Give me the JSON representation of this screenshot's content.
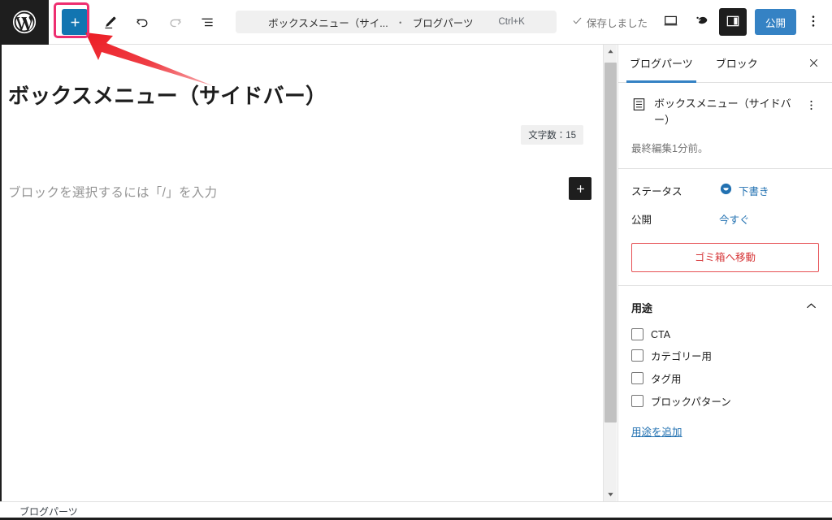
{
  "toolbar": {
    "logo_icon": "wordpress-logo-icon",
    "inserter_label": "+",
    "edit_icon": "pencil-icon",
    "undo_icon": "undo-icon",
    "redo_icon": "redo-icon",
    "listview_icon": "list-view-icon",
    "command_bar": {
      "title": "ボックスメニュー（サイ...",
      "separator": "・",
      "post_type": "ブログパーツ",
      "shortcut": "Ctrl+K"
    },
    "saved_status": "保存しました",
    "saved_check_icon": "check-icon",
    "view_icon": "desktop-preview-icon",
    "jetpack_icon": "jetpack-icon",
    "settings_icon": "settings-sidebar-icon",
    "publish_label": "公開",
    "more_icon": "more-options-icon"
  },
  "editor": {
    "post_title": "ボックスメニュー（サイドバー）",
    "char_count": "文字数：15",
    "block_placeholder": "ブロックを選択するには「/」を入力",
    "block_inserter_label": "+"
  },
  "sidebar": {
    "tabs": [
      {
        "label": "ブログパーツ",
        "active": true
      },
      {
        "label": "ブロック",
        "active": false
      }
    ],
    "close_icon": "close-icon",
    "document": {
      "icon": "document-icon",
      "title": "ボックスメニュー（サイドバー）",
      "kebab_icon": "more-options-icon",
      "last_edited": "最終編集1分前。"
    },
    "status_row": {
      "label": "ステータス",
      "value": "下書き",
      "icon": "draft-status-icon"
    },
    "publish_row": {
      "label": "公開",
      "value": "今すぐ"
    },
    "trash_label": "ゴミ箱へ移動",
    "usage_panel": {
      "title": "用途",
      "collapse_icon": "chevron-up-icon",
      "items": [
        {
          "label": "CTA",
          "checked": false
        },
        {
          "label": "カテゴリー用",
          "checked": false
        },
        {
          "label": "タグ用",
          "checked": false
        },
        {
          "label": "ブロックパターン",
          "checked": false
        }
      ],
      "add_link": "用途を追加"
    }
  },
  "scrollbar": {
    "up_icon": "scroll-up-arrow-icon",
    "down_icon": "scroll-down-arrow-icon"
  },
  "bottom": {
    "breadcrumb": "ブログパーツ"
  },
  "annotations": {
    "highlight_color": "#ee2e70",
    "arrow_color": "#ec1c24"
  },
  "colors": {
    "accent_blue": "#3582c4",
    "inserter_blue": "#1275b1",
    "link_blue": "#2271b1",
    "danger_red": "#d63638",
    "dark": "#1e1e1e"
  }
}
